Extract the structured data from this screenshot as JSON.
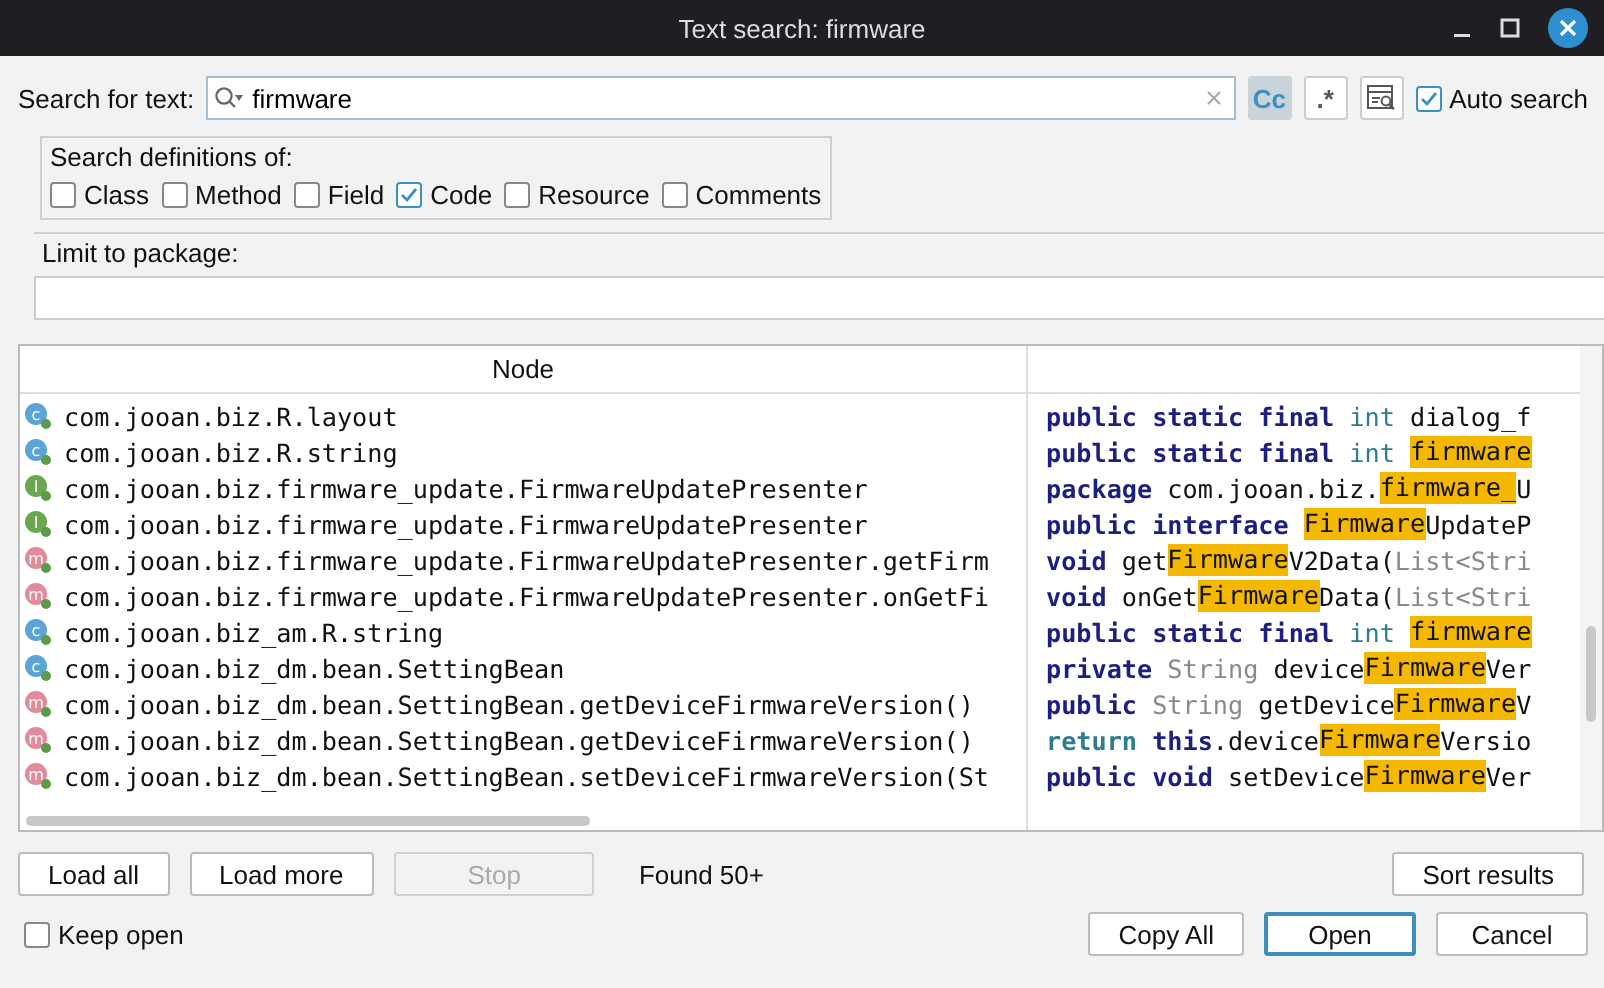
{
  "window": {
    "title": "Text search: firmware"
  },
  "search": {
    "label": "Search for text:",
    "value": "firmware",
    "options": [
      {
        "text": "Cc",
        "selected": true
      },
      {
        "text": ".*",
        "selected": false
      }
    ],
    "auto_search": {
      "label": "Auto search",
      "checked": true
    }
  },
  "definitions": {
    "title": "Search definitions of:",
    "items": [
      {
        "label": "Class",
        "checked": false
      },
      {
        "label": "Method",
        "checked": false
      },
      {
        "label": "Field",
        "checked": false
      },
      {
        "label": "Code",
        "checked": true
      },
      {
        "label": "Resource",
        "checked": false
      },
      {
        "label": "Comments",
        "checked": false
      }
    ]
  },
  "package_limit": {
    "title": "Limit to package:"
  },
  "table": {
    "columns": [
      "Node"
    ],
    "rows": [
      {
        "kind": "class",
        "icon_letter": "c",
        "node": "com.jooan.biz.R.layout",
        "code": [
          {
            "kind": "kw",
            "text": "public static final "
          },
          {
            "kind": "type",
            "text": "int "
          },
          {
            "kind": "plain",
            "text": "dialog_f"
          }
        ]
      },
      {
        "kind": "class",
        "icon_letter": "c",
        "node": "com.jooan.biz.R.string",
        "code": [
          {
            "kind": "kw",
            "text": "public static final "
          },
          {
            "kind": "type",
            "text": "int "
          },
          {
            "kind": "hl",
            "text": "firmware"
          }
        ]
      },
      {
        "kind": "interface",
        "icon_letter": "I",
        "node": "com.jooan.biz.firmware_update.FirmwareUpdatePresenter",
        "code": [
          {
            "kind": "kw",
            "text": "package "
          },
          {
            "kind": "plain",
            "text": "com.jooan.biz."
          },
          {
            "kind": "hl",
            "text": "firmware_"
          },
          {
            "kind": "plain",
            "text": "U"
          }
        ]
      },
      {
        "kind": "interface",
        "icon_letter": "I",
        "node": "com.jooan.biz.firmware_update.FirmwareUpdatePresenter",
        "code": [
          {
            "kind": "kw",
            "text": "public interface "
          },
          {
            "kind": "hl",
            "text": "Firmware"
          },
          {
            "kind": "plain",
            "text": "UpdateP"
          }
        ]
      },
      {
        "kind": "method",
        "icon_letter": "m",
        "node": "com.jooan.biz.firmware_update.FirmwareUpdatePresenter.getFirm",
        "code": [
          {
            "kind": "kw",
            "text": "void "
          },
          {
            "kind": "plain",
            "text": "get"
          },
          {
            "kind": "hl",
            "text": "Firmware"
          },
          {
            "kind": "plain",
            "text": "V2Data("
          },
          {
            "kind": "muted",
            "text": "List<Stri"
          }
        ]
      },
      {
        "kind": "method",
        "icon_letter": "m",
        "node": "com.jooan.biz.firmware_update.FirmwareUpdatePresenter.onGetFi",
        "code": [
          {
            "kind": "kw",
            "text": "void "
          },
          {
            "kind": "plain",
            "text": "onGet"
          },
          {
            "kind": "hl",
            "text": "Firmware"
          },
          {
            "kind": "plain",
            "text": "Data("
          },
          {
            "kind": "muted",
            "text": "List<Stri"
          }
        ]
      },
      {
        "kind": "class",
        "icon_letter": "c",
        "node": "com.jooan.biz_am.R.string",
        "code": [
          {
            "kind": "kw",
            "text": "public static final "
          },
          {
            "kind": "type",
            "text": "int "
          },
          {
            "kind": "hl",
            "text": "firmware"
          }
        ]
      },
      {
        "kind": "class",
        "icon_letter": "c",
        "node": "com.jooan.biz_dm.bean.SettingBean",
        "code": [
          {
            "kind": "kw",
            "text": "private "
          },
          {
            "kind": "muted",
            "text": "String "
          },
          {
            "kind": "plain",
            "text": "device"
          },
          {
            "kind": "hl",
            "text": "Firmware"
          },
          {
            "kind": "plain",
            "text": "Ver"
          }
        ]
      },
      {
        "kind": "method",
        "icon_letter": "m",
        "node": "com.jooan.biz_dm.bean.SettingBean.getDeviceFirmwareVersion()",
        "code": [
          {
            "kind": "kw",
            "text": "public "
          },
          {
            "kind": "muted",
            "text": "String "
          },
          {
            "kind": "plain",
            "text": "getDevice"
          },
          {
            "kind": "hl",
            "text": "Firmware"
          },
          {
            "kind": "plain",
            "text": "V"
          }
        ]
      },
      {
        "kind": "method",
        "icon_letter": "m",
        "node": "com.jooan.biz_dm.bean.SettingBean.getDeviceFirmwareVersion()",
        "code": [
          {
            "kind": "ret",
            "text": "return "
          },
          {
            "kind": "kw",
            "text": "this"
          },
          {
            "kind": "plain",
            "text": ".device"
          },
          {
            "kind": "hl",
            "text": "Firmware"
          },
          {
            "kind": "plain",
            "text": "Versio"
          }
        ]
      },
      {
        "kind": "method",
        "icon_letter": "m",
        "node": "com.jooan.biz_dm.bean.SettingBean.setDeviceFirmwareVersion(St",
        "code": [
          {
            "kind": "kw",
            "text": "public void "
          },
          {
            "kind": "plain",
            "text": "setDevice"
          },
          {
            "kind": "hl",
            "text": "Firmware"
          },
          {
            "kind": "plain",
            "text": "Ver"
          }
        ]
      }
    ]
  },
  "actions": [
    {
      "label": "Load all",
      "disabled": false
    },
    {
      "label": "Load more",
      "disabled": false
    },
    {
      "label": "Stop",
      "disabled": true
    }
  ],
  "found": "Found 50+",
  "sort_button": "Sort results",
  "keep_open": {
    "label": "Keep open",
    "checked": false
  },
  "buttons": [
    {
      "label": "Copy All",
      "selected": false
    },
    {
      "label": "Open",
      "selected": true
    },
    {
      "label": "Cancel",
      "selected": false
    }
  ]
}
